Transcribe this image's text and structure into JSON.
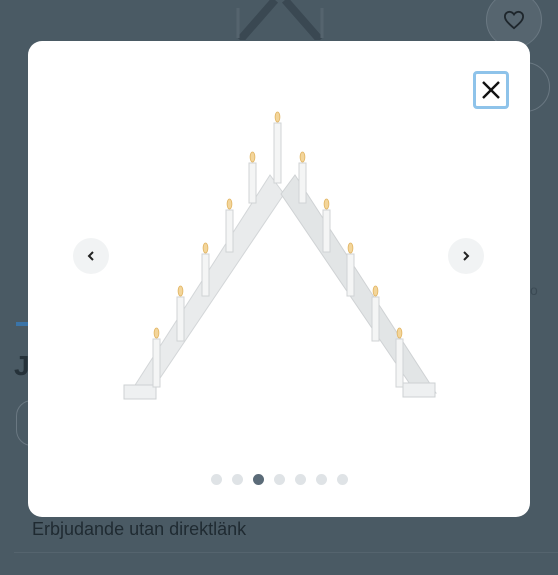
{
  "background": {
    "offer_text": "Erbjudande utan direktlänk",
    "heading_fragment": "Jo",
    "favorite_icon": "heart-icon",
    "side_link_fragment": "o"
  },
  "modal": {
    "close_icon": "close-icon",
    "prev_icon": "chevron-left-icon",
    "next_icon": "chevron-right-icon",
    "image_subject": "candle-bridge-icon",
    "image_count": 7,
    "active_index": 2
  },
  "colors": {
    "overlay": "#475761",
    "modal": "#ffffff",
    "close_focus": "#8ec3ea",
    "dot_active": "#5b6b78",
    "dot_inactive": "#dfe3e6"
  }
}
